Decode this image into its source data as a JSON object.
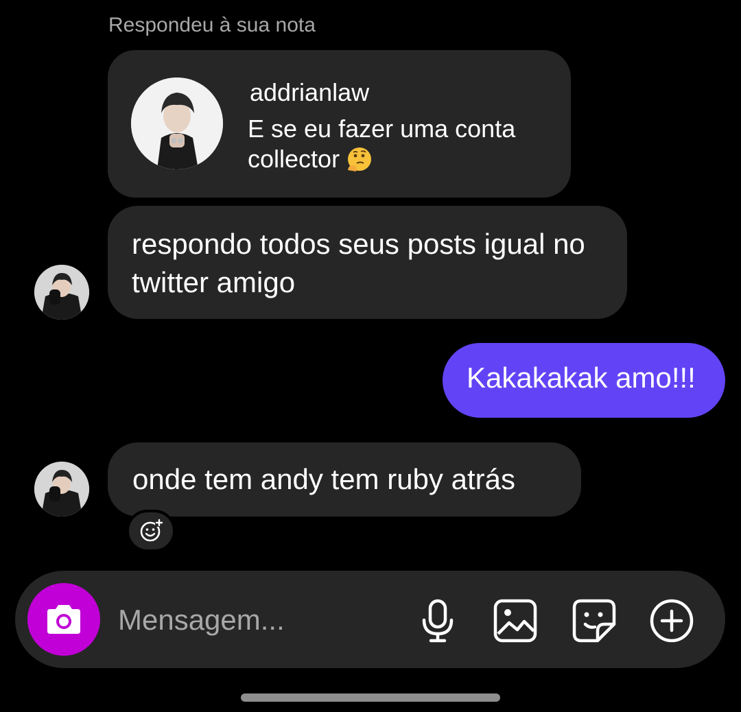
{
  "thread": {
    "reply_context": "Respondeu à sua nota",
    "note": {
      "username": "addrianlaw",
      "text": "E se eu fazer uma conta collector",
      "emoji": "thinking-face-icon"
    },
    "messages": [
      {
        "direction": "incoming",
        "text": "respondo todos seus posts igual no twitter amigo"
      },
      {
        "direction": "outgoing",
        "text": "Kakakakak amo!!!"
      },
      {
        "direction": "incoming",
        "text": "onde tem andy tem ruby atrás"
      }
    ]
  },
  "composer": {
    "placeholder": "Mensagem...",
    "icons": [
      "camera-icon",
      "microphone-icon",
      "gallery-icon",
      "sticker-icon",
      "plus-icon"
    ]
  },
  "colors": {
    "background": "#000000",
    "incoming_bubble": "#262626",
    "outgoing_bubble": "#6244f6",
    "camera_button": "#c000d6",
    "secondary_text": "#a8a8a8"
  }
}
